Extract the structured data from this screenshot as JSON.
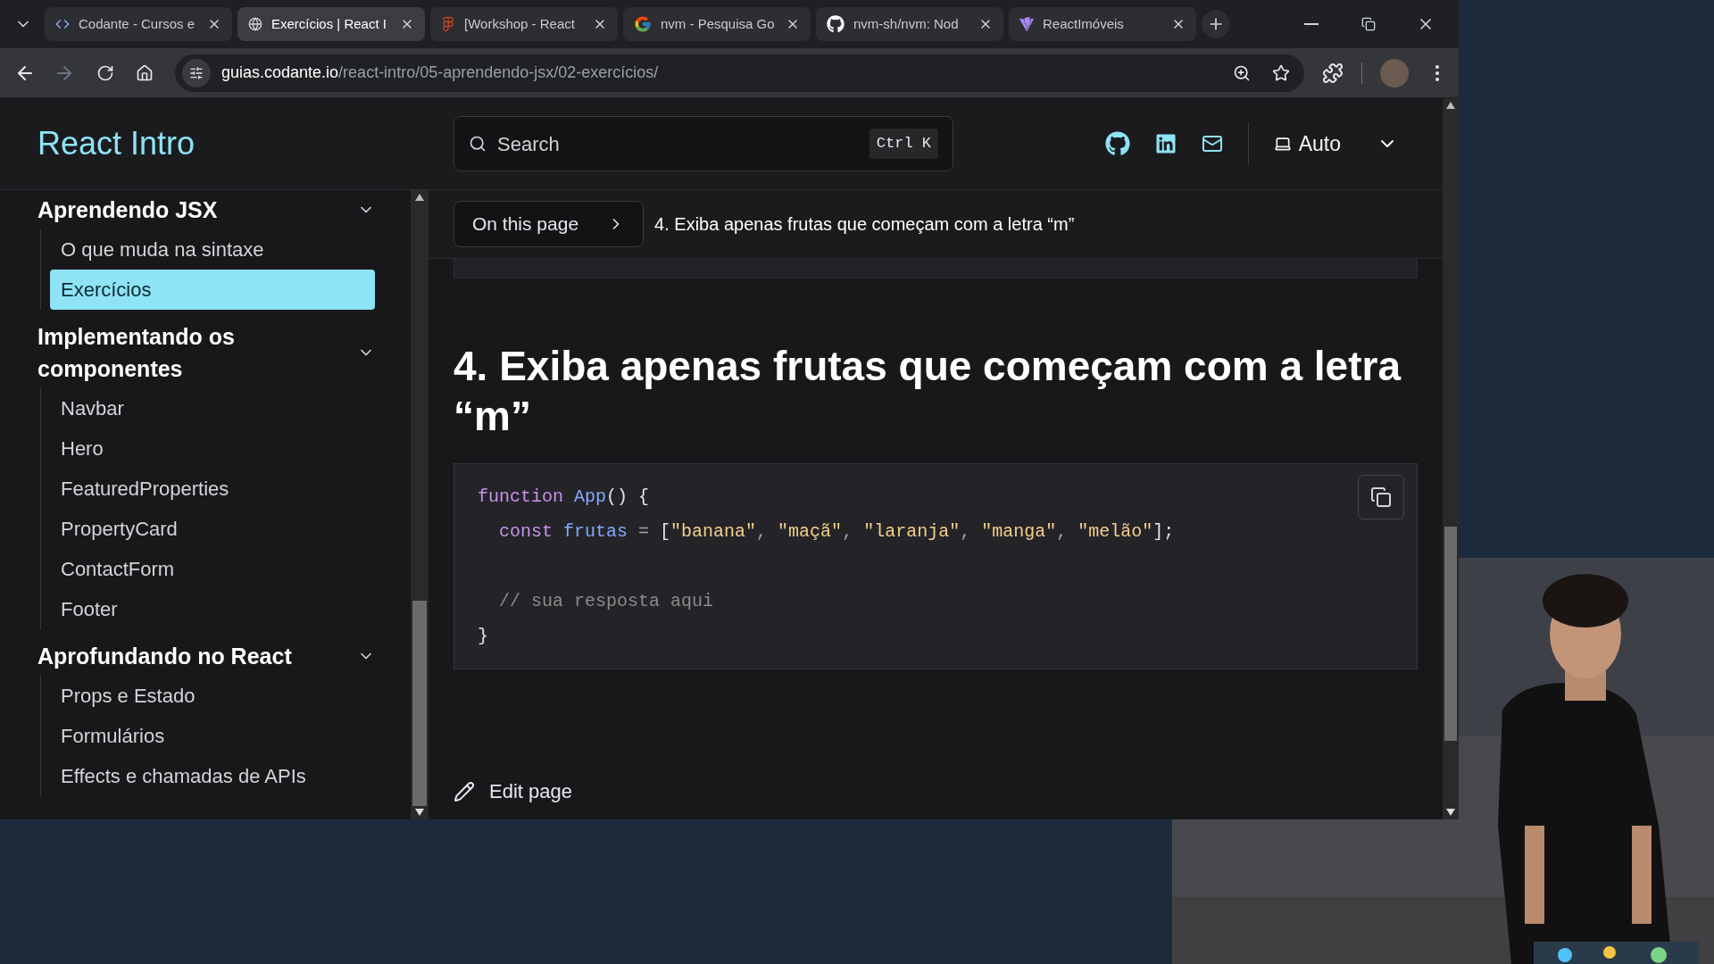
{
  "browser": {
    "tabs": [
      {
        "kind": "code",
        "title": "Codante - Cursos e",
        "selected": false
      },
      {
        "kind": "globe",
        "title": "Exercícios | React I",
        "selected": true
      },
      {
        "kind": "figma",
        "title": "[Workshop - React",
        "selected": false
      },
      {
        "kind": "google",
        "title": "nvm - Pesquisa Go",
        "selected": false
      },
      {
        "kind": "github",
        "title": "nvm-sh/nvm: Nod",
        "selected": false
      },
      {
        "kind": "vite",
        "title": "ReactImóveis",
        "selected": false
      }
    ],
    "address": {
      "host": "guias.codante.io",
      "path": "/react-intro/05-aprendendo-jsx/02-exercícios/"
    }
  },
  "site": {
    "title": "React Intro",
    "search": {
      "placeholder": "Search",
      "shortcut": "Ctrl K"
    },
    "theme": "Auto"
  },
  "sidebar": {
    "sections": [
      {
        "title": "Aprendendo JSX",
        "expanded": true,
        "items": [
          {
            "label": "O que muda na sintaxe",
            "selected": false
          },
          {
            "label": "Exercícios",
            "selected": true
          }
        ]
      },
      {
        "title": "Implementando os componentes",
        "expanded": true,
        "items": [
          {
            "label": "Navbar",
            "selected": false
          },
          {
            "label": "Hero",
            "selected": false
          },
          {
            "label": "FeaturedProperties",
            "selected": false
          },
          {
            "label": "PropertyCard",
            "selected": false
          },
          {
            "label": "ContactForm",
            "selected": false
          },
          {
            "label": "Footer",
            "selected": false
          }
        ]
      },
      {
        "title": "Aprofundando no React",
        "expanded": true,
        "items": [
          {
            "label": "Props e Estado",
            "selected": false
          },
          {
            "label": "Formulários",
            "selected": false
          },
          {
            "label": "Effects e chamadas de APIs",
            "selected": false
          }
        ]
      }
    ]
  },
  "toc": {
    "button": "On this page",
    "current": "4. Exiba apenas frutas que começam com a letra “m”"
  },
  "article": {
    "heading": "4. Exiba apenas frutas que começam com a letra “m”",
    "code": [
      {
        "kind": "keyword",
        "text": "function "
      },
      {
        "kind": "function",
        "text": "App"
      },
      {
        "kind": "plain",
        "text": "() {\n  "
      },
      {
        "kind": "keyword",
        "text": "const "
      },
      {
        "kind": "function",
        "text": "frutas "
      },
      {
        "kind": "punct",
        "text": "= "
      },
      {
        "kind": "plain",
        "text": "["
      },
      {
        "kind": "string",
        "text": "\"banana\""
      },
      {
        "kind": "punct",
        "text": ", "
      },
      {
        "kind": "string",
        "text": "\"maçã\""
      },
      {
        "kind": "punct",
        "text": ", "
      },
      {
        "kind": "string",
        "text": "\"laranja\""
      },
      {
        "kind": "punct",
        "text": ", "
      },
      {
        "kind": "string",
        "text": "\"manga\""
      },
      {
        "kind": "punct",
        "text": ", "
      },
      {
        "kind": "string",
        "text": "\"melão\""
      },
      {
        "kind": "plain",
        "text": "];\n\n  "
      },
      {
        "kind": "comment",
        "text": "// sua resposta aqui"
      },
      {
        "kind": "plain",
        "text": "\n}"
      }
    ],
    "edit_link": "Edit page"
  }
}
